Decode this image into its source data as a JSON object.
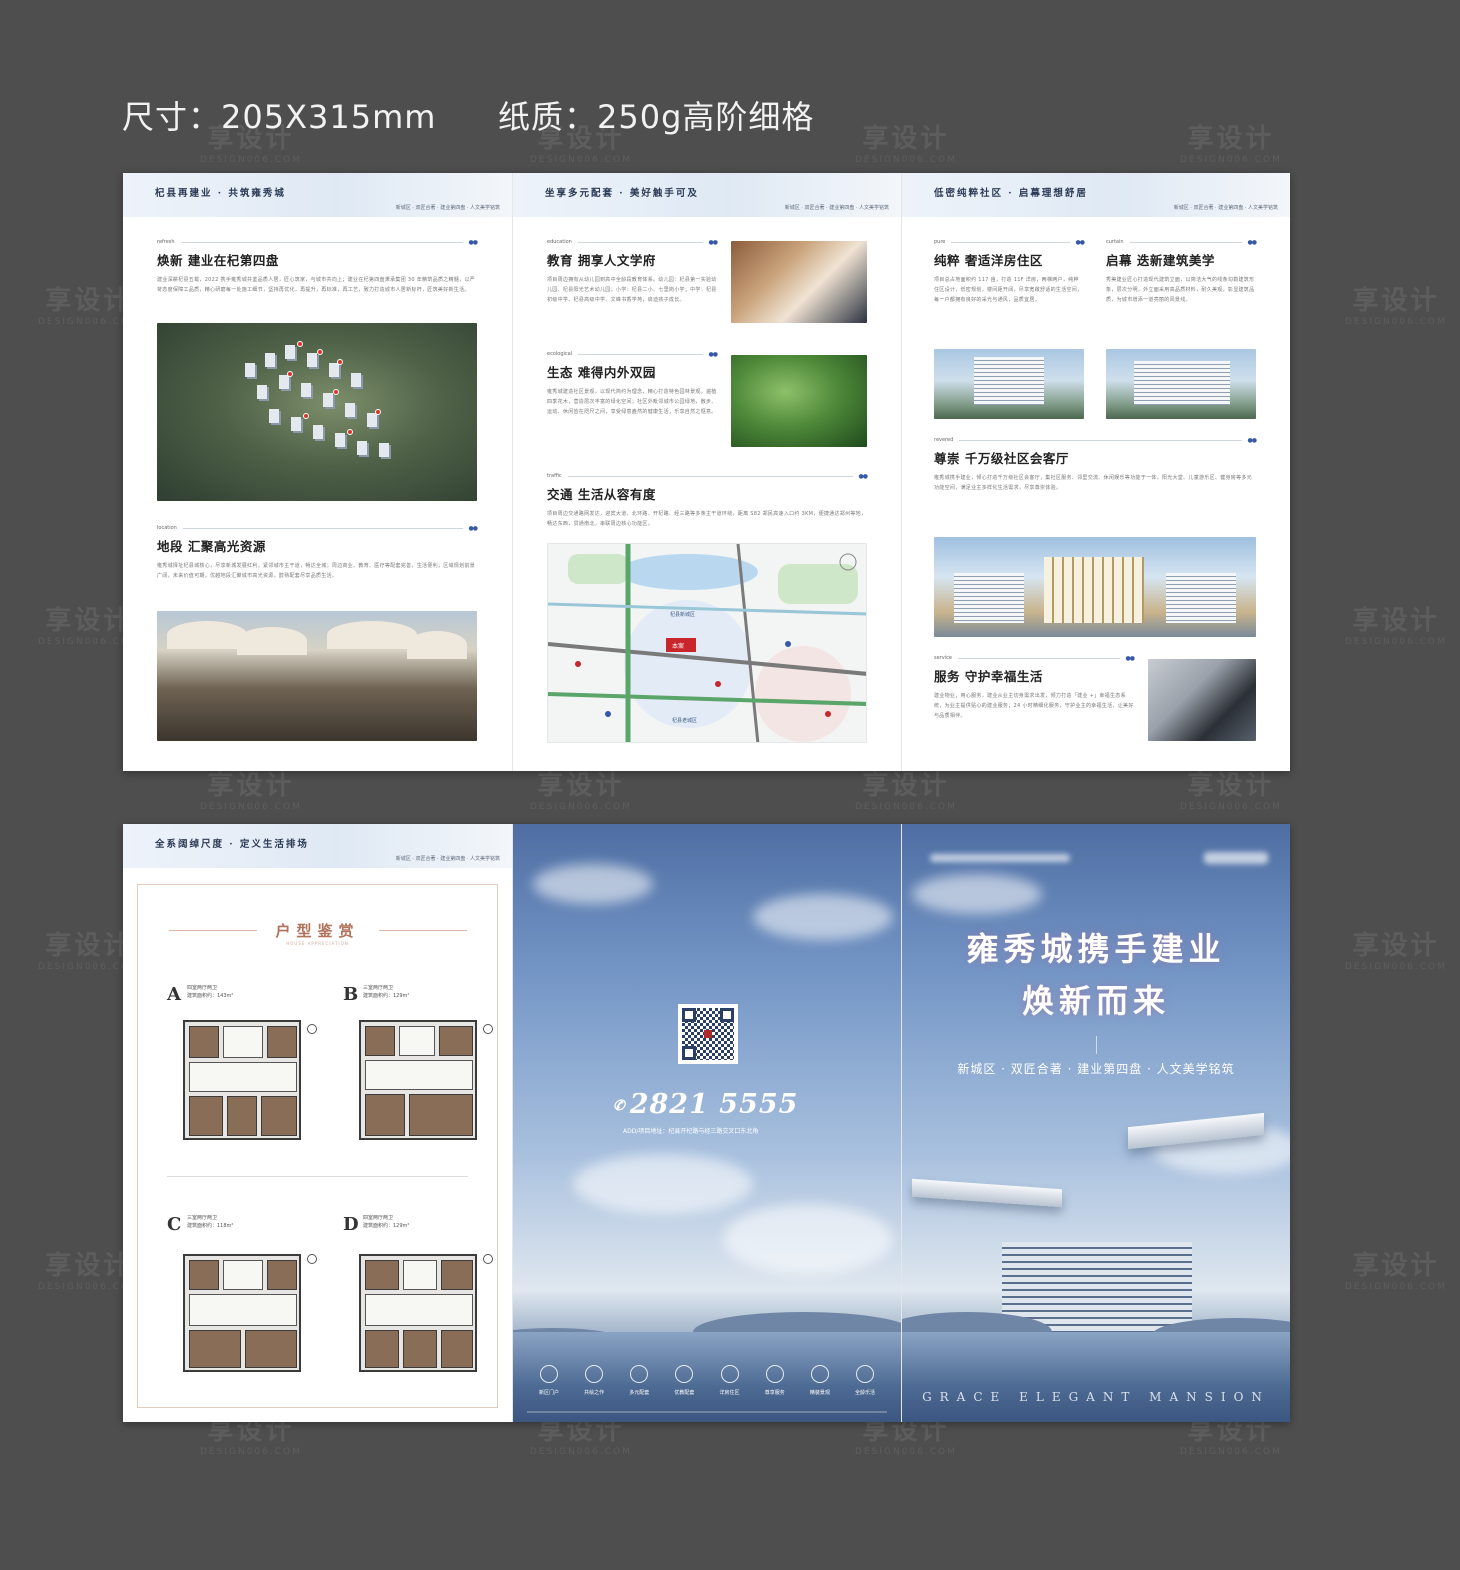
{
  "specs": {
    "size": "尺寸：205X315mm",
    "paper": "纸质：250g高阶细格"
  },
  "watermark": {
    "cn": "享设计",
    "en": "DESIGN006.COM"
  },
  "page1": {
    "header": "杞县再建业 · 共筑雍秀城",
    "header_tabs": "新城区 · 双匠合著 · 建业第四盘 · 人文美学铭筑",
    "s1": {
      "tag": "refresh",
      "title": "焕新 建业在杞第四盘",
      "text": "建业深耕杞县五载，2022 携手雍秀城共鉴品质人居，匠心筑家，与城市共向上；建业在杞第四盘秉承集团 30 年精筑品质之精髓，以严苛态度保障工品质，精心研磨每一处施工细节，坚持再优化，再提升，再标准，再工艺，致力打造城市人居新标杆，匠筑美好新生活。"
    },
    "s2": {
      "tag": "location",
      "title": "地段 汇聚高光资源",
      "text": "雍秀城择址杞县城核心，尽享新城发展红利。紧邻城市主干道，畅达全城；周边商业、教育、医疗等配套完善，生活便利；区域规划前景广阔，未来价值可期，优越地段汇聚城市高光资源，醇熟配套尽享品质生活。"
    }
  },
  "page2": {
    "header": "坐享多元配套 · 美好触手可及",
    "header_tabs": "新城区 · 双匠合著 · 建业第四盘 · 人文美学铭筑",
    "s1": {
      "tag": "education",
      "title": "教育 拥享人文学府",
      "text": "项目周边拥有从幼儿园到高中全龄段教育体系。幼儿园：杞县第一实验幼儿园、杞县阳光艺术幼儿园；小学：杞县二小、七里岗小学；中学：杞县初级中学、杞县高级中学、文峰书香学苑，启迪孩子成长。"
    },
    "s2": {
      "tag": "ecological",
      "title": "生态 难得内外双园",
      "text": "雍秀城建造社区景观，以现代简约为理念，精心打造特色园林景观，遍植四季花木，营造层次丰富的绿化空间；社区外毗邻城市公园绿地，散步、运动、休闲皆在咫尺之间，享受绿意盎然的健康生活，乐享自然之惬意。"
    },
    "s3": {
      "tag": "traffic",
      "title": "交通 生活从容有度",
      "text": "项目周边交通路网发达，迎宾大道、北环路、开杞路、经三路等多条主干道环绕，距离 S82 郑民高速入口约 3KM，便捷通达郑州等地，畅达东西，贯通南北，串联周边核心功能区。"
    },
    "map": {
      "park": "湿地公园",
      "project": "本案",
      "district": "杞县新城区",
      "old_district": "杞县老城区"
    }
  },
  "page3": {
    "header": "低密纯粹社区 · 启幕理想舒居",
    "header_tabs": "新城区 · 双匠合著 · 建业第四盘 · 人文美学铭筑",
    "s1": {
      "tag": "pure",
      "title": "纯粹 奢适洋房住区",
      "text": "项目总占地面积约 117 亩，打造 11F 洋房，两梯两户，纯粹住区设计，低密规划，楼间距开阔，尽享宽敞舒适的生活空间，每一户都拥有良好的采光与通风，品质宜居。"
    },
    "s2": {
      "tag": "curtain",
      "title": "启幕 迭新建筑美学",
      "text": "秀美建业匠心打造现代建筑立面，以简洁大气的线条勾勒建筑形象，层次分明，外立面采用高品质材料，耐久美观，彰显建筑品质，为城市增添一道亮丽的风景线。"
    },
    "s3": {
      "tag": "revered",
      "title": "尊崇 千万级社区会客厅",
      "text": "雍秀城携手建业，倾心打造千万级社区会客厅，集社区服务、邻里交流、休闲娱乐等功能于一体，阳光大堂、儿童游乐区、健身房等多元功能空间，满足业主多样化生活需求，尽享尊崇体验。"
    },
    "s4": {
      "tag": "service",
      "title": "服务 守护幸福生活",
      "text": "建业物业，用心服务，建业从业主切身需求出发，倾力打造「建业 +」幸福生态系统，为业主提供贴心的建业服务；24 小时精细化服务，守护业主的幸福生活，让美好与品质相伴。"
    }
  },
  "page4": {
    "header": "全系阔绰尺度 · 定义生活排场",
    "header_tabs": "新城区 · 双匠合著 · 建业第四盘 · 人文美学铭筑",
    "title": "户型鉴赏",
    "title_en": "HOUSE APPRECIATION",
    "units": [
      {
        "letter": "A",
        "type": "四室两厅两卫",
        "area": "建筑面积约：143m²"
      },
      {
        "letter": "B",
        "type": "三室两厅两卫",
        "area": "建筑面积约：129m²"
      },
      {
        "letter": "C",
        "type": "三室两厅两卫",
        "area": "建筑面积约：118m²"
      },
      {
        "letter": "D",
        "type": "四室两厅两卫",
        "area": "建筑面积约：129m²"
      }
    ]
  },
  "page5": {
    "phone": "2821 5555",
    "address": "ADD/项目地址：杞县开杞路与经三路交叉口东北角",
    "icons": [
      "新区门户",
      "共绘之作",
      "多元配套",
      "优教配套",
      "洋房住区",
      "尊享服务",
      "精装景观",
      "全龄乐活"
    ]
  },
  "page6": {
    "title_line1": "雍秀城携手建业",
    "title_line2": "焕新而来",
    "subtitle": "新城区 · 双匠合著 · 建业第四盘 · 人文美学铭筑",
    "footer_en": "GRACE ELEGANT MANSION"
  },
  "colors": {
    "background": "#4e4e4e",
    "accent_blue": "#3658a8",
    "accent_rose": "#b0725a"
  }
}
